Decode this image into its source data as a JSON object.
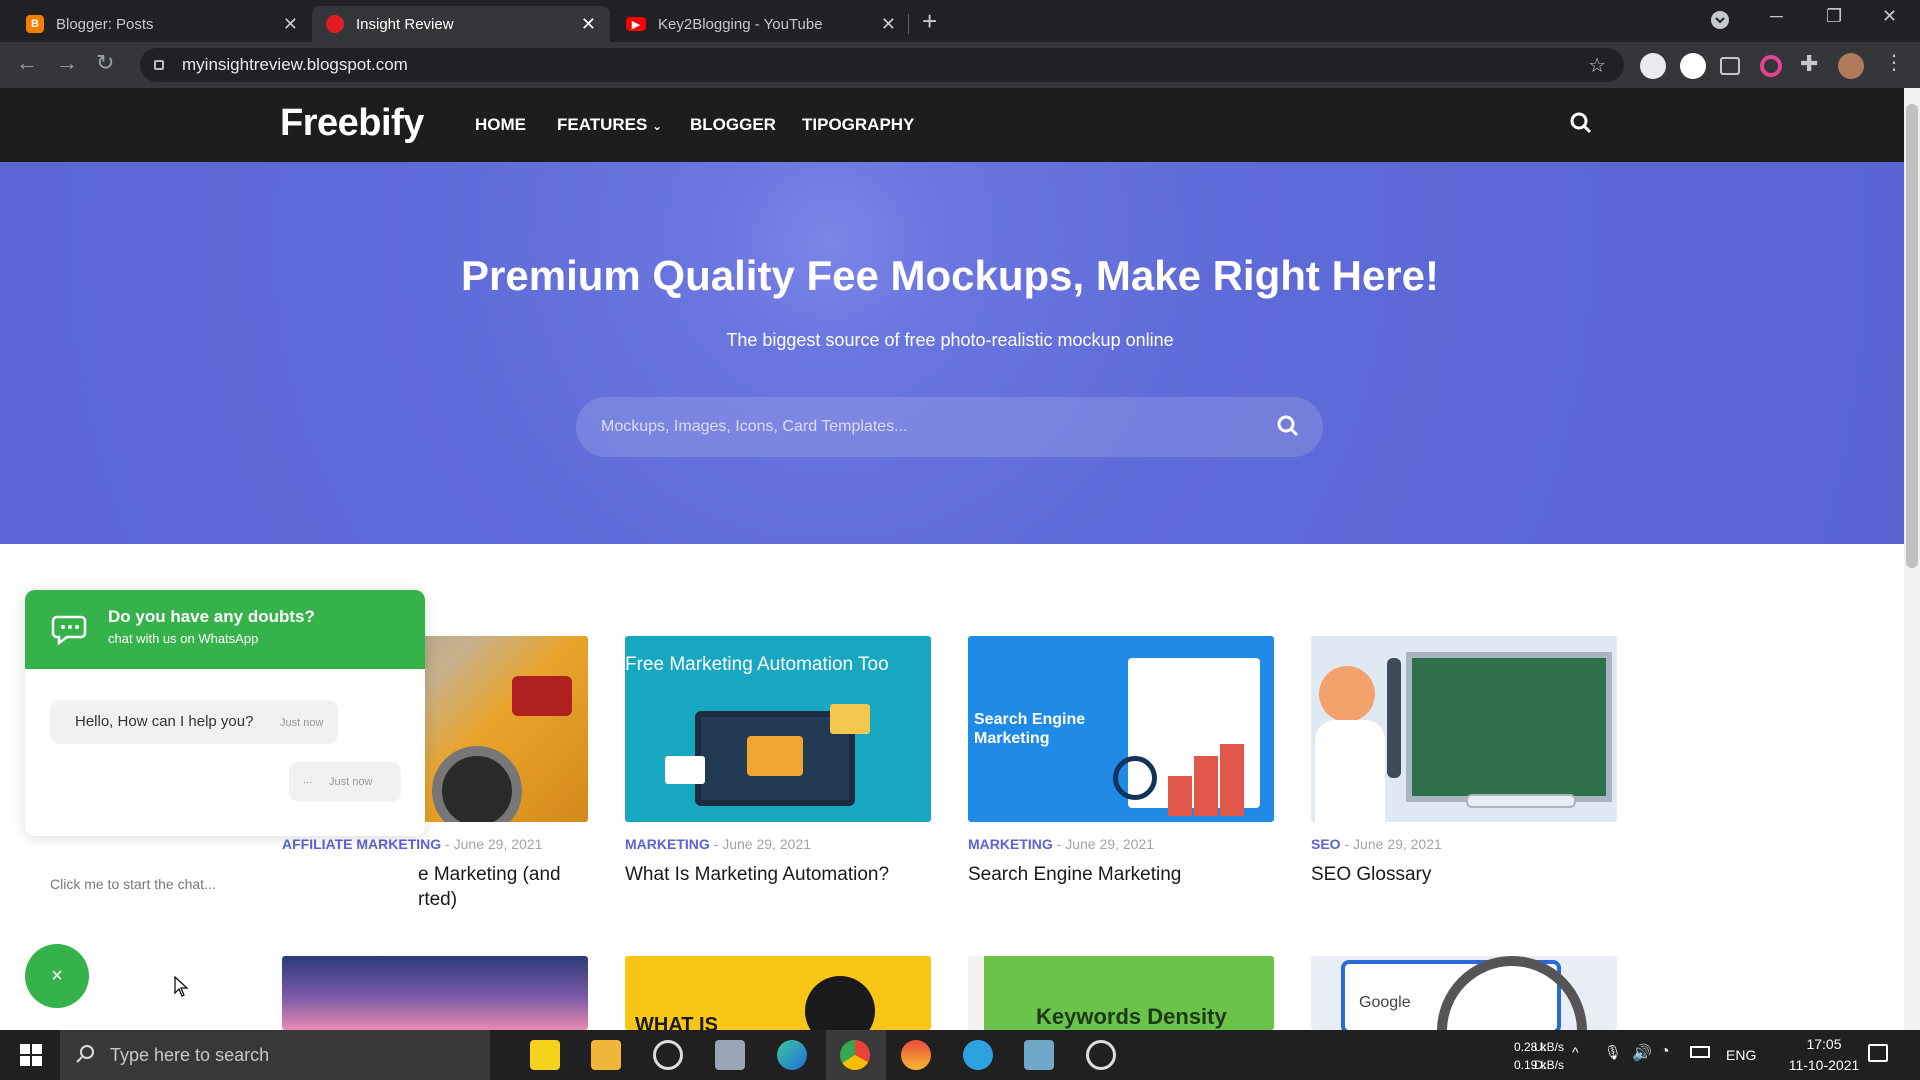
{
  "browser": {
    "tabs": [
      {
        "title": "Blogger: Posts",
        "active": false
      },
      {
        "title": "Insight Review",
        "active": true
      },
      {
        "title": "Key2Blogging - YouTube",
        "active": false
      }
    ],
    "url": "myinsightreview.blogspot.com"
  },
  "site": {
    "logo": "Freebify",
    "nav": [
      "HOME",
      "FEATURES",
      "BLOGGER",
      "TIPOGRAPHY"
    ]
  },
  "hero": {
    "title": "Premium Quality Fee Mockups, Make Right Here!",
    "subtitle": "The biggest source of free photo-realistic mockup online",
    "search_placeholder": "Mockups, Images, Icons, Card Templates..."
  },
  "posts": [
    {
      "category": "AFFILIATE MARKETING",
      "date": "June 29, 2021",
      "title": "e Marketing (and",
      "title_line2": "rted)"
    },
    {
      "category": "MARKETING",
      "date": "June 29, 2021",
      "title": "What Is Marketing Automation?",
      "thumb_text": "Free Marketing Automation Too"
    },
    {
      "category": "MARKETING",
      "date": "June 29, 2021",
      "title": "Search Engine Marketing",
      "thumb_text": "Search Engine\nMarketing"
    },
    {
      "category": "SEO",
      "date": "June 29, 2021",
      "title": "SEO Glossary"
    }
  ],
  "second_row": {
    "whatis_text": "WHAT IS",
    "keywords_text": "Keywords Density",
    "google_text": "Google"
  },
  "whatsapp": {
    "question": "Do you have any doubts?",
    "sub": "chat with us on WhatsApp",
    "message": "Hello, How can I help you?",
    "time1": "Just now",
    "typing": "...",
    "time2": "Just now",
    "start_text": "Click me to start the chat...",
    "close": "×"
  },
  "taskbar": {
    "search_text": "Type here to search",
    "net_up_label": "U:",
    "net_up": "0.28 kB/s",
    "net_down_label": "D:",
    "net_down": "0.19 kB/s",
    "lang": "ENG",
    "time": "17:05",
    "date": "11-10-2021"
  },
  "colors": {
    "accent": "#5a64d3",
    "whatsapp": "#35b34a",
    "header": "#1d1d1f"
  }
}
